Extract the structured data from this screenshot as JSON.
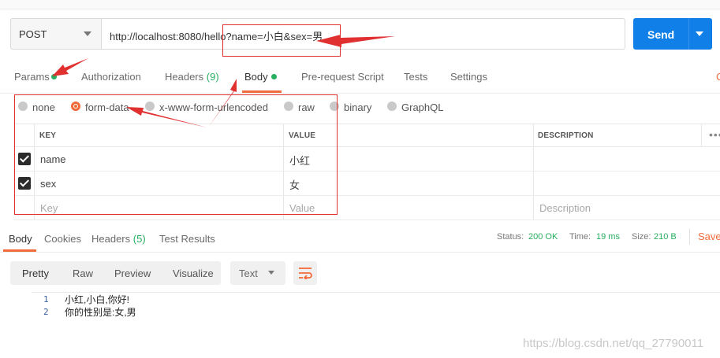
{
  "request": {
    "method": "POST",
    "url": "http://localhost:8080/hello?name=小白&sex=男",
    "send_label": "Send"
  },
  "tabs": [
    {
      "label": "Params"
    },
    {
      "label": "Authorization"
    },
    {
      "label": "Headers",
      "count": "(9)"
    },
    {
      "label": "Body"
    },
    {
      "label": "Pre-request Script"
    },
    {
      "label": "Tests"
    },
    {
      "label": "Settings"
    }
  ],
  "tabs_overflow": "C",
  "body_types": [
    "none",
    "form-data",
    "x-www-form-urlencoded",
    "raw",
    "binary",
    "GraphQL"
  ],
  "kv_table": {
    "headers": [
      "KEY",
      "VALUE",
      "DESCRIPTION"
    ],
    "rows": [
      {
        "key": "name",
        "value": "小红"
      },
      {
        "key": "sex",
        "value": "女"
      }
    ],
    "placeholders": {
      "key": "Key",
      "value": "Value",
      "description": "Description"
    },
    "menu_glyph": "•••"
  },
  "response": {
    "tabs": [
      {
        "label": "Body"
      },
      {
        "label": "Cookies"
      },
      {
        "label": "Headers",
        "count": "(5)"
      },
      {
        "label": "Test Results"
      }
    ],
    "status_label": "Status:",
    "status": "200 OK",
    "time_label": "Time:",
    "time": "19 ms",
    "size_label": "Size:",
    "size": "210 B",
    "save_label": "Save",
    "view_modes": [
      "Pretty",
      "Raw",
      "Preview",
      "Visualize"
    ],
    "format": "Text",
    "lines": [
      {
        "n": "1",
        "text": "小红,小白,你好!"
      },
      {
        "n": "2",
        "text": "你的性别是:女,男"
      }
    ]
  },
  "watermark": "https://blog.csdn.net/qq_27790011",
  "colors": {
    "accent": "#f26b3a",
    "send": "#1080e8",
    "ok": "#27ae60",
    "annotation": "#e03030"
  }
}
